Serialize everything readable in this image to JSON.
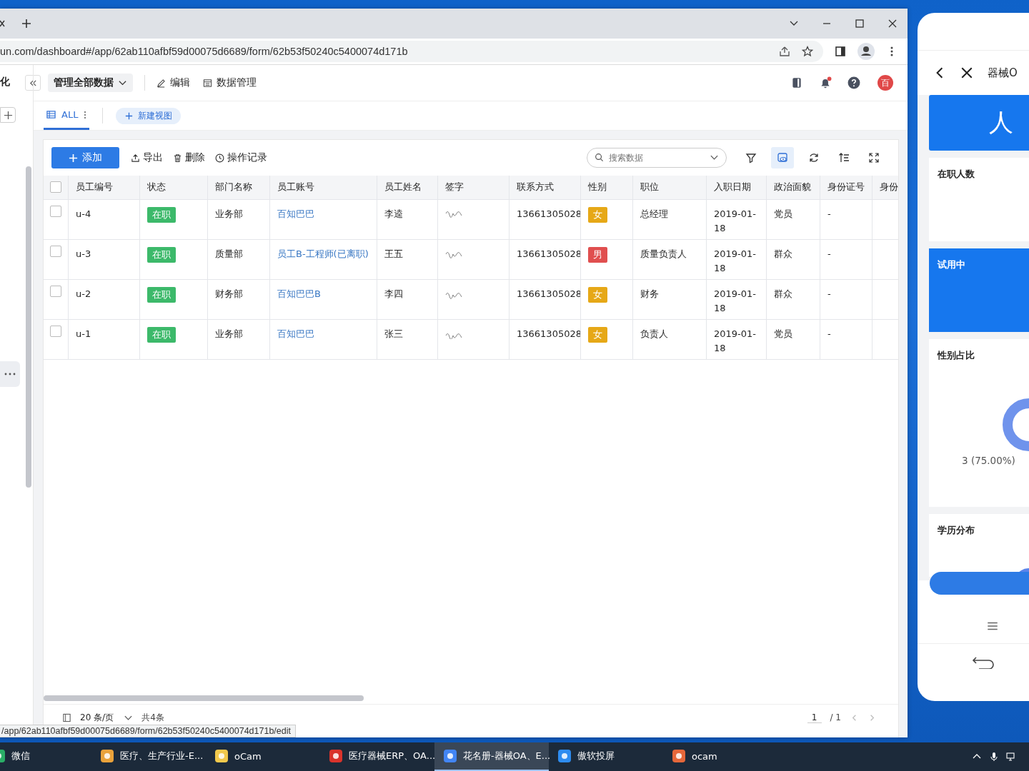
{
  "browser": {
    "url": "un.com/dashboard#/app/62ab110afbf59d00075d6689/form/62b53f50240c5400074d171b"
  },
  "app": {
    "sidebar_title": "化",
    "scope": "管理全部数据",
    "actions": [
      {
        "label": "编辑",
        "kind": "edit"
      },
      {
        "label": "数据管理",
        "kind": "data"
      }
    ],
    "avatar": "百",
    "notification": true
  },
  "views": [
    {
      "label": "ALL",
      "selected": true
    }
  ],
  "new_view": "新建视图",
  "toolbar": {
    "add": "添加",
    "actions": [
      {
        "label": "导出",
        "kind": "export"
      },
      {
        "label": "删除",
        "kind": "delete"
      },
      {
        "label": "操作记录",
        "kind": "history"
      }
    ],
    "search_placeholder": "搜索数据"
  },
  "table": {
    "all_checked": false,
    "columns": [
      "员工编号",
      "状态",
      "部门名称",
      "员工账号",
      "员工姓名",
      "签字",
      "联系方式",
      "性别",
      "职位",
      "入职日期",
      "政治面貌",
      "身份证号",
      "身份"
    ],
    "rows": [
      {
        "checked": false,
        "id": "u-4",
        "status": "在职",
        "dept": "业务部",
        "account": "百知巴巴",
        "name": "李逵",
        "phone": "13661305028",
        "gender": "女",
        "color": "#e6a817",
        "position": "总经理",
        "date": "2019-01-18",
        "politics": "党员",
        "id_no": "-"
      },
      {
        "checked": false,
        "id": "u-3",
        "status": "在职",
        "dept": "质量部",
        "account": "员工B-工程师(已离职)",
        "name": "王五",
        "phone": "13661305028",
        "gender": "男",
        "color": "#e04f4f",
        "position": "质量负责人",
        "date": "2019-01-18",
        "politics": "群众",
        "id_no": "-"
      },
      {
        "checked": false,
        "id": "u-2",
        "status": "在职",
        "dept": "财务部",
        "account": "百知巴巴B",
        "name": "李四",
        "phone": "13661305028",
        "gender": "女",
        "color": "#e6a817",
        "position": "财务",
        "date": "2019-01-18",
        "politics": "群众",
        "id_no": "-"
      },
      {
        "checked": false,
        "id": "u-1",
        "status": "在职",
        "dept": "业务部",
        "account": "百知巴巴",
        "name": "张三",
        "phone": "13661305028",
        "gender": "女",
        "color": "#e6a817",
        "position": "负责人",
        "date": "2019-01-18",
        "politics": "党员",
        "id_no": "-"
      }
    ]
  },
  "pagination": {
    "page_size": "20 条/页",
    "total": "共4条",
    "page": "1",
    "pages": "/ 1"
  },
  "status_url": "/app/62ab110afbf59d00075d6689/form/62b53f50240c5400074d171b/edit",
  "phone": {
    "title": "器械O",
    "banner": "人",
    "cards": [
      {
        "title": "在职人数",
        "kind": "plain"
      },
      {
        "title": "试用中",
        "kind": "accent"
      },
      {
        "title": "性别占比",
        "kind": "chart",
        "label": "3 (75.00%)"
      },
      {
        "title": "学历分布",
        "kind": "chart"
      }
    ]
  },
  "taskbar": [
    {
      "label": "微信",
      "kind": "chat",
      "selected": false
    },
    {
      "label": "医疗、生产行业-E...",
      "kind": "browser2",
      "selected": false
    },
    {
      "label": "oCam",
      "kind": "folder",
      "selected": false
    },
    {
      "label": "医疗器械ERP、OA...",
      "kind": "office",
      "selected": false
    },
    {
      "label": "花名册-器械OA、E...",
      "kind": "chrome",
      "selected": true
    },
    {
      "label": "傲软投屏",
      "kind": "cast",
      "selected": false
    },
    {
      "label": "ocam",
      "kind": "recorder",
      "selected": false
    }
  ]
}
